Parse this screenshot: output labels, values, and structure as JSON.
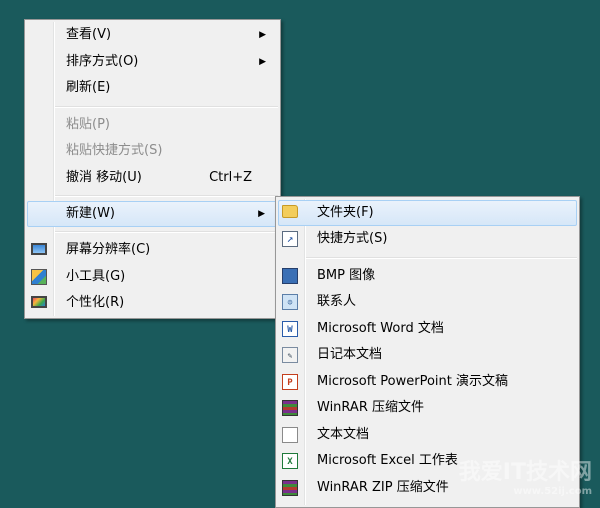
{
  "context_menu": {
    "items": [
      {
        "label": "查看(V)",
        "submenu": true
      },
      {
        "label": "排序方式(O)",
        "submenu": true
      },
      {
        "label": "刷新(E)"
      },
      {
        "label": "粘贴(P)",
        "disabled": true
      },
      {
        "label": "粘贴快捷方式(S)",
        "disabled": true
      },
      {
        "label": "撤消 移动(U)",
        "shortcut": "Ctrl+Z"
      },
      {
        "label": "新建(W)",
        "submenu": true,
        "highlighted": true
      },
      {
        "label": "屏幕分辨率(C)",
        "icon": "monitor-icon"
      },
      {
        "label": "小工具(G)",
        "icon": "gadgets-icon"
      },
      {
        "label": "个性化(R)",
        "icon": "personalize-icon"
      }
    ]
  },
  "new_submenu": {
    "items": [
      {
        "label": "文件夹(F)",
        "icon": "folder-icon"
      },
      {
        "label": "快捷方式(S)",
        "icon": "shortcut-icon"
      },
      {
        "label": "BMP 图像",
        "icon": "bmp-image-icon"
      },
      {
        "label": "联系人",
        "icon": "contact-icon"
      },
      {
        "label": "Microsoft Word 文档",
        "icon": "word-document-icon"
      },
      {
        "label": "日记本文档",
        "icon": "journal-document-icon"
      },
      {
        "label": "Microsoft PowerPoint 演示文稿",
        "icon": "powerpoint-icon"
      },
      {
        "label": "WinRAR 压缩文件",
        "icon": "winrar-archive-icon"
      },
      {
        "label": "文本文档",
        "icon": "text-document-icon"
      },
      {
        "label": "Microsoft Excel 工作表",
        "icon": "excel-icon"
      },
      {
        "label": "WinRAR ZIP 压缩文件",
        "icon": "winrar-zip-icon"
      }
    ]
  },
  "watermark": {
    "title": "我爱IT技术网",
    "url": "www.52ij.com"
  },
  "colors": {
    "desktop": "#1a5a5c",
    "menu_bg": "#f0f0f0",
    "highlight_border": "#a8d0f4",
    "disabled_text": "#8d8d8d"
  }
}
